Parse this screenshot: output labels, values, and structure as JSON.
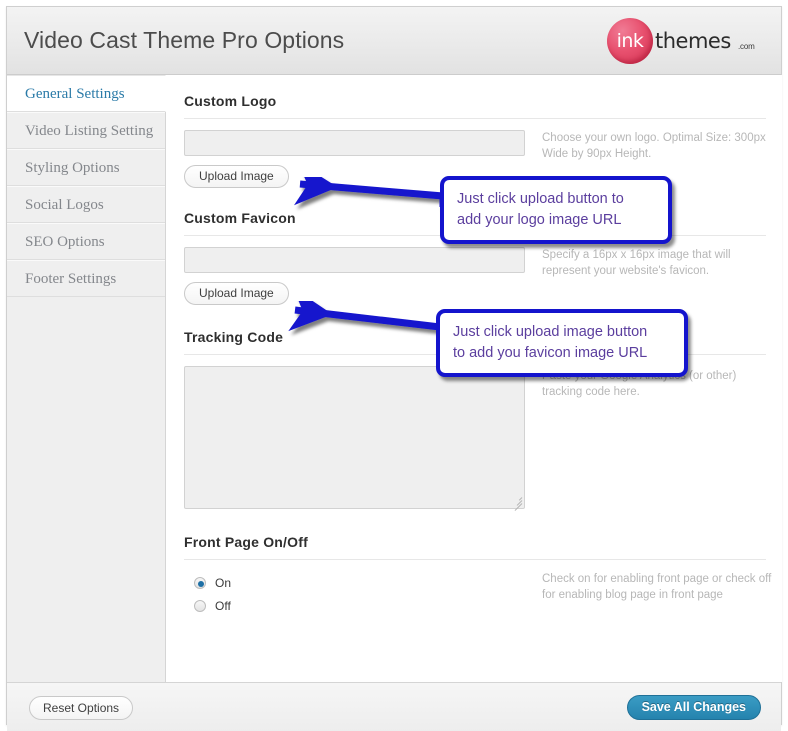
{
  "header": {
    "title": "Video Cast Theme Pro Options",
    "logo": {
      "mark": "ink",
      "word": "themes",
      "suffix": ".com"
    }
  },
  "sidebar": {
    "items": [
      {
        "label": "General Settings",
        "active": true
      },
      {
        "label": "Video Listing Setting",
        "active": false
      },
      {
        "label": "Styling Options",
        "active": false
      },
      {
        "label": "Social Logos",
        "active": false
      },
      {
        "label": "SEO Options",
        "active": false
      },
      {
        "label": "Footer Settings",
        "active": false
      }
    ]
  },
  "sections": {
    "custom_logo": {
      "title": "Custom Logo",
      "input_value": "",
      "input_placeholder": "",
      "button_label": "Upload Image",
      "hint": "Choose your own logo. Optimal Size: 300px Wide by 90px Height."
    },
    "custom_favicon": {
      "title": "Custom Favicon",
      "input_value": "",
      "input_placeholder": "",
      "button_label": "Upload Image",
      "hint": "Specify a 16px x 16px image that will represent your website's favicon."
    },
    "tracking_code": {
      "title": "Tracking Code",
      "textarea_value": "",
      "textarea_placeholder": "",
      "hint": "Paste your Google Analytics (or other) tracking code here."
    },
    "front_page": {
      "title": "Front Page On/Off",
      "options": [
        {
          "label": "On",
          "selected": true
        },
        {
          "label": "Off",
          "selected": false
        }
      ],
      "hint": "Check on for enabling front page or check off for enabling blog page in front page"
    }
  },
  "footer": {
    "reset_label": "Reset Options",
    "save_label": "Save All Changes"
  },
  "annotations": [
    {
      "text": "Just click upload button to\nadd your logo image URL"
    },
    {
      "text": "Just click upload image button\nto add you favicon image URL"
    }
  ],
  "colors": {
    "accent_blue": "#2583ae",
    "active_nav": "#2b7ba8",
    "callout_border": "#1414cd",
    "callout_text": "#5b3e9e",
    "logo_pink": "#e8516f"
  }
}
